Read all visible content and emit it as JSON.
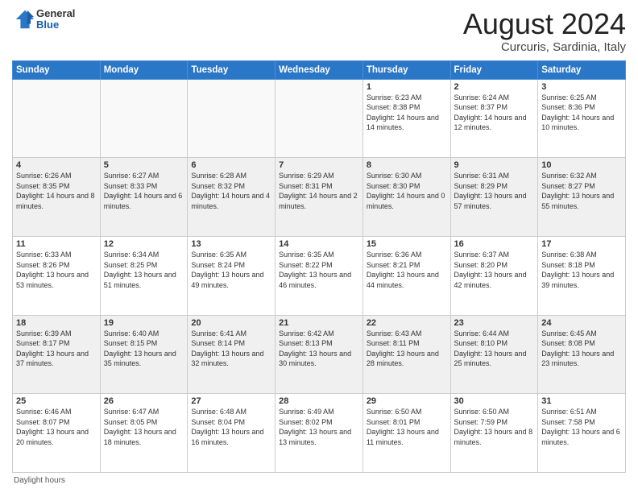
{
  "header": {
    "logo_general": "General",
    "logo_blue": "Blue",
    "month_year": "August 2024",
    "location": "Curcuris, Sardinia, Italy"
  },
  "days_of_week": [
    "Sunday",
    "Monday",
    "Tuesday",
    "Wednesday",
    "Thursday",
    "Friday",
    "Saturday"
  ],
  "weeks": [
    [
      {
        "day": "",
        "info": ""
      },
      {
        "day": "",
        "info": ""
      },
      {
        "day": "",
        "info": ""
      },
      {
        "day": "",
        "info": ""
      },
      {
        "day": "1",
        "info": "Sunrise: 6:23 AM\nSunset: 8:38 PM\nDaylight: 14 hours and 14 minutes."
      },
      {
        "day": "2",
        "info": "Sunrise: 6:24 AM\nSunset: 8:37 PM\nDaylight: 14 hours and 12 minutes."
      },
      {
        "day": "3",
        "info": "Sunrise: 6:25 AM\nSunset: 8:36 PM\nDaylight: 14 hours and 10 minutes."
      }
    ],
    [
      {
        "day": "4",
        "info": "Sunrise: 6:26 AM\nSunset: 8:35 PM\nDaylight: 14 hours and 8 minutes."
      },
      {
        "day": "5",
        "info": "Sunrise: 6:27 AM\nSunset: 8:33 PM\nDaylight: 14 hours and 6 minutes."
      },
      {
        "day": "6",
        "info": "Sunrise: 6:28 AM\nSunset: 8:32 PM\nDaylight: 14 hours and 4 minutes."
      },
      {
        "day": "7",
        "info": "Sunrise: 6:29 AM\nSunset: 8:31 PM\nDaylight: 14 hours and 2 minutes."
      },
      {
        "day": "8",
        "info": "Sunrise: 6:30 AM\nSunset: 8:30 PM\nDaylight: 14 hours and 0 minutes."
      },
      {
        "day": "9",
        "info": "Sunrise: 6:31 AM\nSunset: 8:29 PM\nDaylight: 13 hours and 57 minutes."
      },
      {
        "day": "10",
        "info": "Sunrise: 6:32 AM\nSunset: 8:27 PM\nDaylight: 13 hours and 55 minutes."
      }
    ],
    [
      {
        "day": "11",
        "info": "Sunrise: 6:33 AM\nSunset: 8:26 PM\nDaylight: 13 hours and 53 minutes."
      },
      {
        "day": "12",
        "info": "Sunrise: 6:34 AM\nSunset: 8:25 PM\nDaylight: 13 hours and 51 minutes."
      },
      {
        "day": "13",
        "info": "Sunrise: 6:35 AM\nSunset: 8:24 PM\nDaylight: 13 hours and 49 minutes."
      },
      {
        "day": "14",
        "info": "Sunrise: 6:35 AM\nSunset: 8:22 PM\nDaylight: 13 hours and 46 minutes."
      },
      {
        "day": "15",
        "info": "Sunrise: 6:36 AM\nSunset: 8:21 PM\nDaylight: 13 hours and 44 minutes."
      },
      {
        "day": "16",
        "info": "Sunrise: 6:37 AM\nSunset: 8:20 PM\nDaylight: 13 hours and 42 minutes."
      },
      {
        "day": "17",
        "info": "Sunrise: 6:38 AM\nSunset: 8:18 PM\nDaylight: 13 hours and 39 minutes."
      }
    ],
    [
      {
        "day": "18",
        "info": "Sunrise: 6:39 AM\nSunset: 8:17 PM\nDaylight: 13 hours and 37 minutes."
      },
      {
        "day": "19",
        "info": "Sunrise: 6:40 AM\nSunset: 8:15 PM\nDaylight: 13 hours and 35 minutes."
      },
      {
        "day": "20",
        "info": "Sunrise: 6:41 AM\nSunset: 8:14 PM\nDaylight: 13 hours and 32 minutes."
      },
      {
        "day": "21",
        "info": "Sunrise: 6:42 AM\nSunset: 8:13 PM\nDaylight: 13 hours and 30 minutes."
      },
      {
        "day": "22",
        "info": "Sunrise: 6:43 AM\nSunset: 8:11 PM\nDaylight: 13 hours and 28 minutes."
      },
      {
        "day": "23",
        "info": "Sunrise: 6:44 AM\nSunset: 8:10 PM\nDaylight: 13 hours and 25 minutes."
      },
      {
        "day": "24",
        "info": "Sunrise: 6:45 AM\nSunset: 8:08 PM\nDaylight: 13 hours and 23 minutes."
      }
    ],
    [
      {
        "day": "25",
        "info": "Sunrise: 6:46 AM\nSunset: 8:07 PM\nDaylight: 13 hours and 20 minutes."
      },
      {
        "day": "26",
        "info": "Sunrise: 6:47 AM\nSunset: 8:05 PM\nDaylight: 13 hours and 18 minutes."
      },
      {
        "day": "27",
        "info": "Sunrise: 6:48 AM\nSunset: 8:04 PM\nDaylight: 13 hours and 16 minutes."
      },
      {
        "day": "28",
        "info": "Sunrise: 6:49 AM\nSunset: 8:02 PM\nDaylight: 13 hours and 13 minutes."
      },
      {
        "day": "29",
        "info": "Sunrise: 6:50 AM\nSunset: 8:01 PM\nDaylight: 13 hours and 11 minutes."
      },
      {
        "day": "30",
        "info": "Sunrise: 6:50 AM\nSunset: 7:59 PM\nDaylight: 13 hours and 8 minutes."
      },
      {
        "day": "31",
        "info": "Sunrise: 6:51 AM\nSunset: 7:58 PM\nDaylight: 13 hours and 6 minutes."
      }
    ]
  ],
  "footer": "Daylight hours"
}
